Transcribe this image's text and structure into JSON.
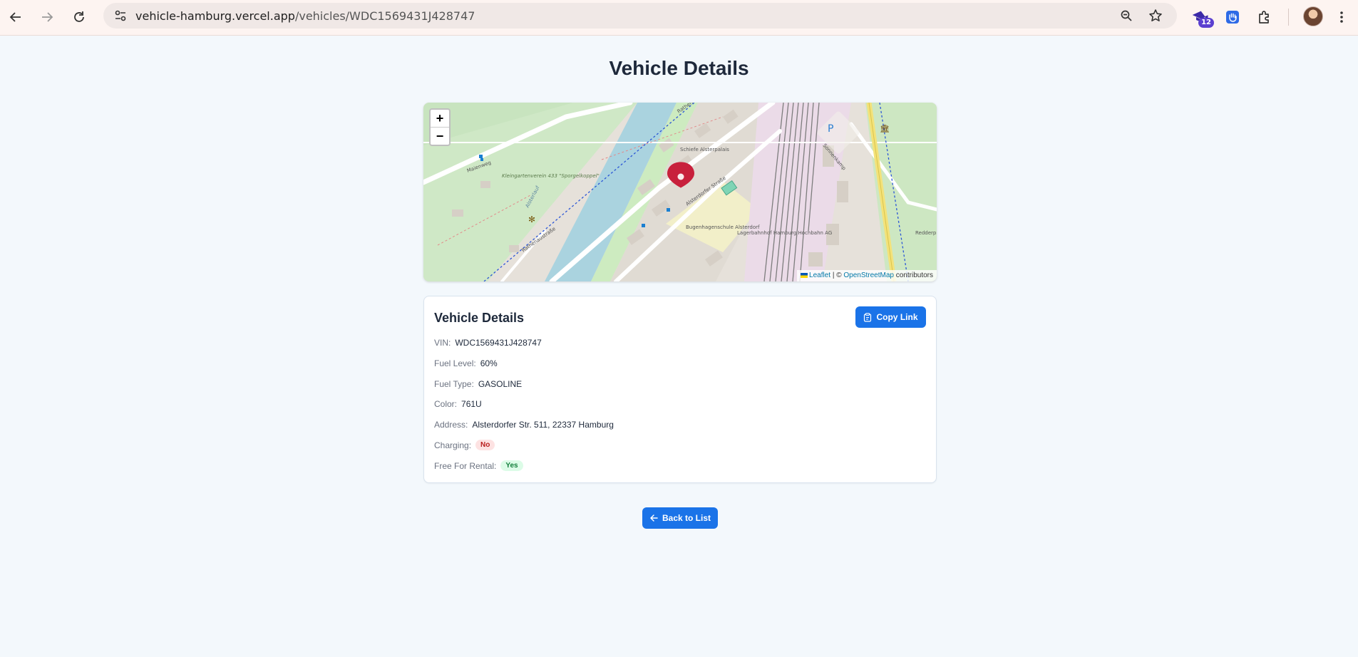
{
  "browser": {
    "url_host": "vehicle-hamburg.vercel.app",
    "url_path": "/vehicles/WDC1569431J428747",
    "extension_badge": "12"
  },
  "page": {
    "title": "Vehicle Details"
  },
  "map": {
    "zoom_in": "+",
    "zoom_out": "−",
    "labels": {
      "street_main": "Alsterdorfer Straße",
      "street_rathenau": "Rathenaustraße",
      "street_maienweg": "Maienweg",
      "school": "Bugenhagenschule Alsterdorf",
      "garden": "Kleingartenverein 433 \"Sporgelkoppel\"",
      "palais": "Schiefe Alsterpalais",
      "river": "Alsterlauf",
      "depot": "Lagerbahnhof Hamburg Hochbahn AG",
      "parking": "P",
      "street_redder": "Redderplatz",
      "street_sonnen": "Sonnenkamp"
    },
    "attribution": {
      "leaflet": "Leaflet",
      "separator": "| ©",
      "osm": "OpenStreetMap",
      "suffix": "contributors"
    }
  },
  "details": {
    "title": "Vehicle Details",
    "copy_button": "Copy Link",
    "vin_label": "VIN:",
    "vin": "WDC1569431J428747",
    "fuel_level_label": "Fuel Level:",
    "fuel_level": "60%",
    "fuel_type_label": "Fuel Type:",
    "fuel_type": "GASOLINE",
    "color_label": "Color:",
    "color": "761U",
    "address_label": "Address:",
    "address": "Alsterdorfer Str. 511, 22337 Hamburg",
    "charging_label": "Charging:",
    "charging": "No",
    "rental_label": "Free For Rental:",
    "rental": "Yes"
  },
  "back_button": "Back to List",
  "colors": {
    "primary": "#1a73e8",
    "marker": "#c8203c",
    "page_bg": "#f3f8fc"
  }
}
